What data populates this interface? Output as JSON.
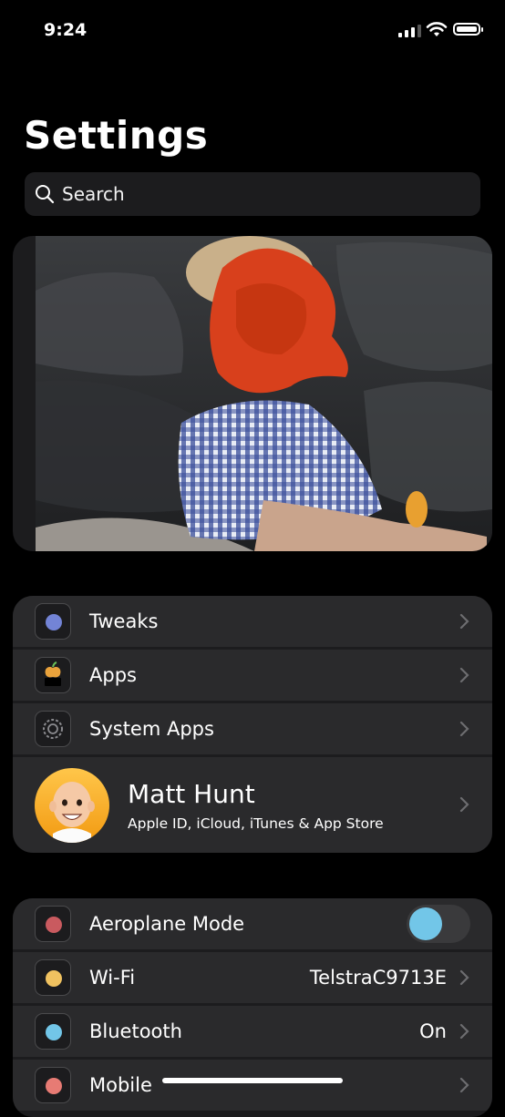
{
  "status_bar": {
    "time": "9:24"
  },
  "header": {
    "title": "Settings"
  },
  "search": {
    "placeholder": "Search"
  },
  "group1": {
    "items": [
      {
        "label": "Tweaks",
        "dot_color": "#7384d6"
      },
      {
        "label": "Apps"
      },
      {
        "label": "System Apps"
      }
    ],
    "profile": {
      "name": "Matt Hunt",
      "subtitle": "Apple ID, iCloud, iTunes & App Store"
    }
  },
  "group2": {
    "items": [
      {
        "label": "Aeroplane Mode",
        "dot_color": "#c95a5f",
        "toggle_on": false
      },
      {
        "label": "Wi-Fi",
        "value": "TelstraC9713E",
        "dot_color": "#f0c260"
      },
      {
        "label": "Bluetooth",
        "value": "On",
        "dot_color": "#72c6e8"
      },
      {
        "label": "Mobile",
        "dot_color": "#e77b74"
      }
    ]
  },
  "colors": {
    "background": "#000000",
    "row_background": "#2a2a2c",
    "toggle_knob": "#72c6e8"
  }
}
